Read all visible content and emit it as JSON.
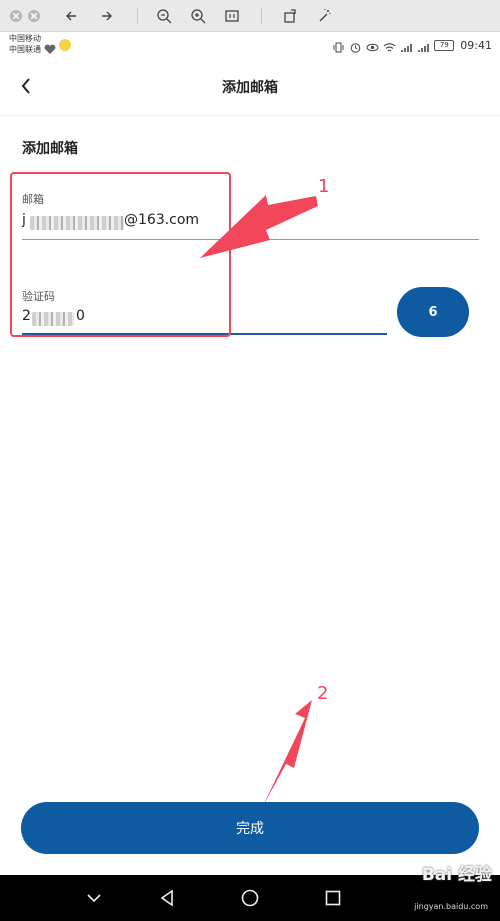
{
  "status_bar": {
    "carrier_1": "中国移动",
    "carrier_2": "中国联通",
    "battery": "79",
    "time": "09:41"
  },
  "header": {
    "title": "添加邮箱"
  },
  "form": {
    "section_title": "添加邮箱",
    "email_label": "邮箱",
    "email_value_prefix": "j",
    "email_value_suffix": "@163.com",
    "code_label": "验证码",
    "code_value_prefix": "2",
    "code_value_suffix": "0",
    "sms_countdown": "6",
    "submit_label": "完成"
  },
  "annotations": {
    "num_1": "1",
    "num_2": "2"
  },
  "watermark": {
    "brand": "Bai 经验",
    "url": "jingyan.baidu.com"
  },
  "colors": {
    "primary": "#0f5ba2",
    "annotation": "#f2475a"
  }
}
